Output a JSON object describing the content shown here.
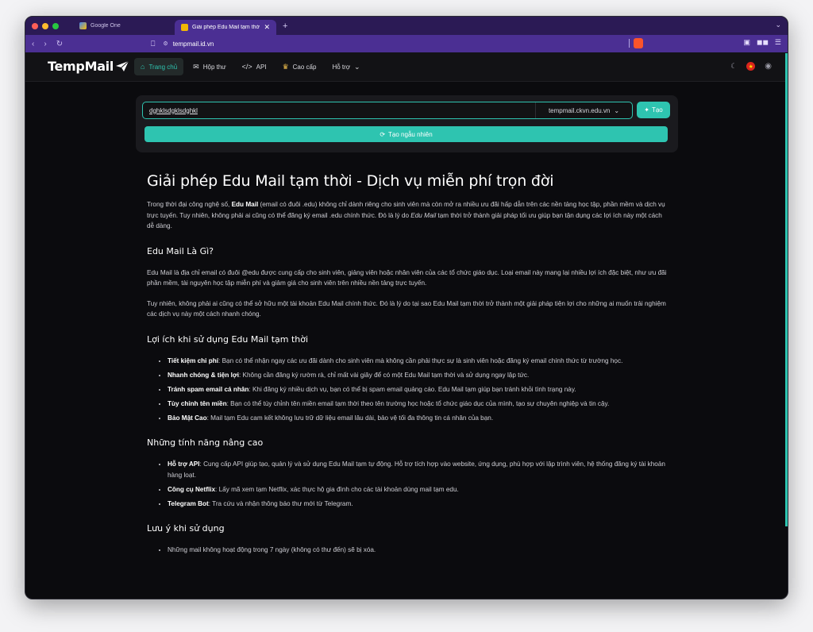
{
  "browser": {
    "tabs": [
      {
        "title": "Google One",
        "favicon_color": "#f4b400"
      },
      {
        "title": "Giải phép Edu Mail tạm thời - Dịch",
        "favicon_color": "#f2b705"
      }
    ],
    "new_tab": "+",
    "url": "tempmail.id.vn",
    "traffic_colors": [
      "#fe5f57",
      "#febc2e",
      "#28c840"
    ]
  },
  "site": {
    "logo": "TempMail",
    "nav": [
      {
        "icon": "home-icon",
        "label": "Trang chủ",
        "active": true
      },
      {
        "icon": "mail-icon",
        "label": "Hộp thư",
        "active": false
      },
      {
        "icon": "code-icon",
        "label": "API",
        "active": false
      },
      {
        "icon": "crown-icon",
        "label": "Cao cấp",
        "active": false
      },
      {
        "icon": "chevron-down-icon",
        "label": "Hỗ trợ",
        "active": false
      }
    ],
    "accent": "#2ec4b0"
  },
  "generator": {
    "email_value": "dghklsdgklsdghkl",
    "domain": "tempmail.ckvn.edu.vn",
    "create_label": "Tạo",
    "random_label": "Tạo ngẫu nhiên"
  },
  "article": {
    "title": "Giải phép Edu Mail tạm thời - Dịch vụ miễn phí trọn đời",
    "intro_a": "Trong thời đại công nghệ số, ",
    "intro_b": "Edu Mail",
    "intro_c": " (email có đuôi .edu) không chỉ dành riêng cho sinh viên mà còn mở ra nhiều ưu đãi hấp dẫn trên các nền tảng học tập, phần mềm và dịch vụ trực tuyến. Tuy nhiên, không phải ai cũng có thể đăng ký email .edu chính thức. Đó là lý do ",
    "intro_d": "Edu Mail",
    "intro_e": " tạm thời trở thành giải pháp tối ưu giúp bạn tận dụng các lợi ích này một cách dễ dàng.",
    "s1_title": "Edu Mail Là Gì?",
    "s1_p1": "Edu Mail là địa chỉ email có đuôi @edu được cung cấp cho sinh viên, giảng viên hoặc nhân viên của các tổ chức giáo dục. Loại email này mang lại nhiều lợi ích đặc biệt, như ưu đãi phần mềm, tài nguyên học tập miễn phí và giảm giá cho sinh viên trên nhiều nền tảng trực tuyến.",
    "s1_p2": "Tuy nhiên, không phải ai cũng có thể sở hữu một tài khoản Edu Mail chính thức. Đó là lý do tại sao Edu Mail tạm thời trở thành một giải pháp tiện lợi cho những ai muốn trải nghiệm các dịch vụ này một cách nhanh chóng.",
    "s2_title": "Lợi ích khi sử dụng Edu Mail tạm thời",
    "s2_items": [
      {
        "b": "Tiết kiệm chi phí",
        "t": ": Bạn có thể nhận ngay các ưu đãi dành cho sinh viên mà không cần phải thực sự là sinh viên hoặc đăng ký email chính thức từ trường học."
      },
      {
        "b": "Nhanh chóng & tiện lợi",
        "t": ": Không cần đăng ký rườm rà, chỉ mất vài giây để có một Edu Mail tạm thời và sử dụng ngay lập tức."
      },
      {
        "b": "Tránh spam email cá nhân",
        "t": ": Khi đăng ký nhiều dịch vụ, bạn có thể bị spam email quảng cáo. Edu Mail tạm giúp bạn tránh khỏi tình trạng này."
      },
      {
        "b": "Tùy chỉnh tên miền",
        "t": ": Bạn có thể tùy chỉnh tên miền email tạm thời theo tên trường học hoặc tổ chức giáo dục của mình, tạo sự chuyên nghiệp và tin cậy."
      },
      {
        "b": "Bảo Mật Cao",
        "t": ": Mail tạm Edu cam kết không lưu trữ dữ liệu email lâu dài, bảo vệ tối đa thông tin cá nhân của bạn."
      }
    ],
    "s3_title": "Những tính năng nâng cao",
    "s3_items": [
      {
        "b": "Hỗ trợ API",
        "t": ": Cung cấp API giúp tạo, quản lý và sử dụng Edu Mail tạm tự động. Hỗ trợ tích hợp vào website, ứng dụng, phù hợp với lập trình viên, hệ thống đăng ký tài khoản hàng loạt."
      },
      {
        "b": "Công cụ Netflix",
        "t": ": Lấy mã xem tạm Netflix, xác thực hộ gia đình cho các tài khoản dùng mail tạm edu."
      },
      {
        "b": "Telegram Bot",
        "t": ": Tra cứu và nhận thông báo thư mới từ Telegram."
      }
    ],
    "s4_title": "Lưu ý khi sử dụng",
    "s4_items": [
      {
        "t": "Những mail không hoạt động trong 7 ngày (không có thư đến) sẽ bị xóa."
      }
    ]
  }
}
